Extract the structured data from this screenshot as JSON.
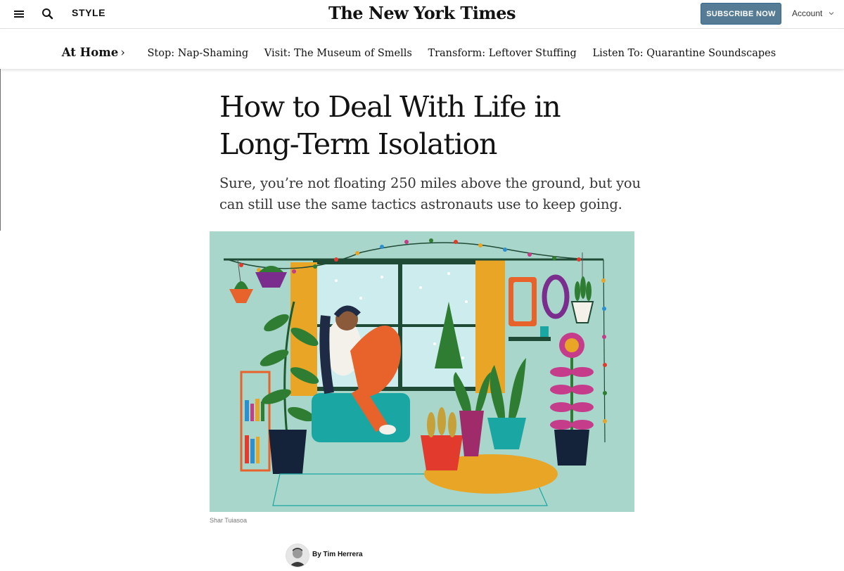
{
  "header": {
    "section": "STYLE",
    "masthead": "The New York Times",
    "subscribe_label": "SUBSCRIBE NOW",
    "account_label": "Account"
  },
  "subnav": {
    "home_label": "At Home",
    "items": [
      {
        "label": "Stop: Nap-Shaming"
      },
      {
        "label": "Visit: The Museum of Smells"
      },
      {
        "label": "Transform: Leftover Stuffing"
      },
      {
        "label": "Listen To: Quarantine Soundscapes"
      }
    ]
  },
  "article": {
    "headline": "How to Deal With Life in Long-Term Isolation",
    "summary": "Sure, you’re not floating 250 miles above the ground, but you can still use the same tactics astronauts use to keep going.",
    "image_credit": "Shar Tuiasoa",
    "byline": "By Tim Herrera"
  },
  "colors": {
    "subscribe_bg": "#567b95",
    "illustration_bg": "#a9d6cb",
    "text": "#121212"
  },
  "icons": [
    "hamburger-menu-icon",
    "search-icon",
    "chevron-down-icon"
  ]
}
